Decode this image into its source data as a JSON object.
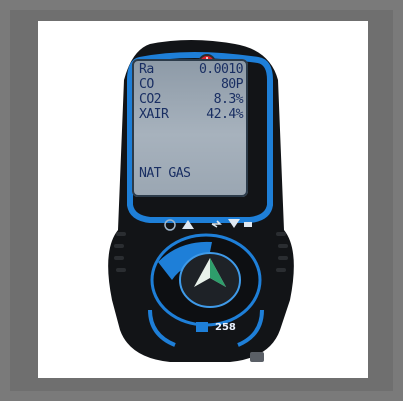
{
  "device": {
    "model": "258",
    "brand_logo_icon": "kane-logo-icon",
    "colors": {
      "body": "#121417",
      "accent": "#1e7fd8",
      "lcd": "#a0adb9",
      "lcd_text": "#1a2f63",
      "power": "#d8202a"
    },
    "display": {
      "rows": [
        {
          "label": "Ra",
          "value": "0.0010"
        },
        {
          "label": "CO",
          "value": "80P"
        },
        {
          "label": "CO2",
          "value": "8.3%"
        },
        {
          "label": "XAIR",
          "value": "42.4%"
        },
        {
          "label": "NAT GAS",
          "value": ""
        }
      ]
    }
  }
}
